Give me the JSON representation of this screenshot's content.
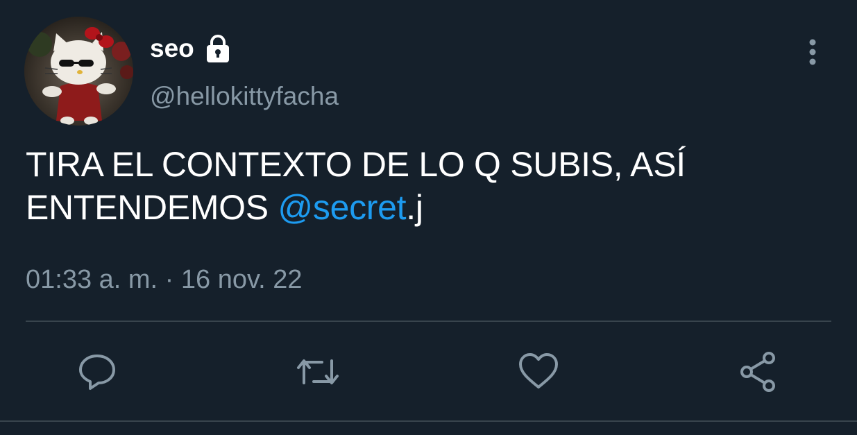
{
  "tweet": {
    "author": {
      "display_name": "seo",
      "handle": "@hellokittyfacha",
      "protected_icon": "lock-icon",
      "avatar": "hello-kitty-avatar"
    },
    "text_main": "TIRA EL CONTEXTO DE LO Q SUBIS, ASÍ ENTENDEMOS ",
    "mention": "@secret",
    "text_suffix": ".j",
    "timestamp": "01:33 a. m. · 16 nov. 22",
    "menu_icon": "more-vertical-icon"
  },
  "actions": [
    {
      "name": "reply",
      "icon": "comment-icon"
    },
    {
      "name": "retweet",
      "icon": "retweet-icon"
    },
    {
      "name": "like",
      "icon": "heart-icon"
    },
    {
      "name": "share",
      "icon": "share-icon"
    }
  ],
  "colors": {
    "background": "#15202b",
    "text": "#ffffff",
    "secondary_text": "#8899a6",
    "link": "#1d9bf0",
    "divider": "#38444d"
  }
}
